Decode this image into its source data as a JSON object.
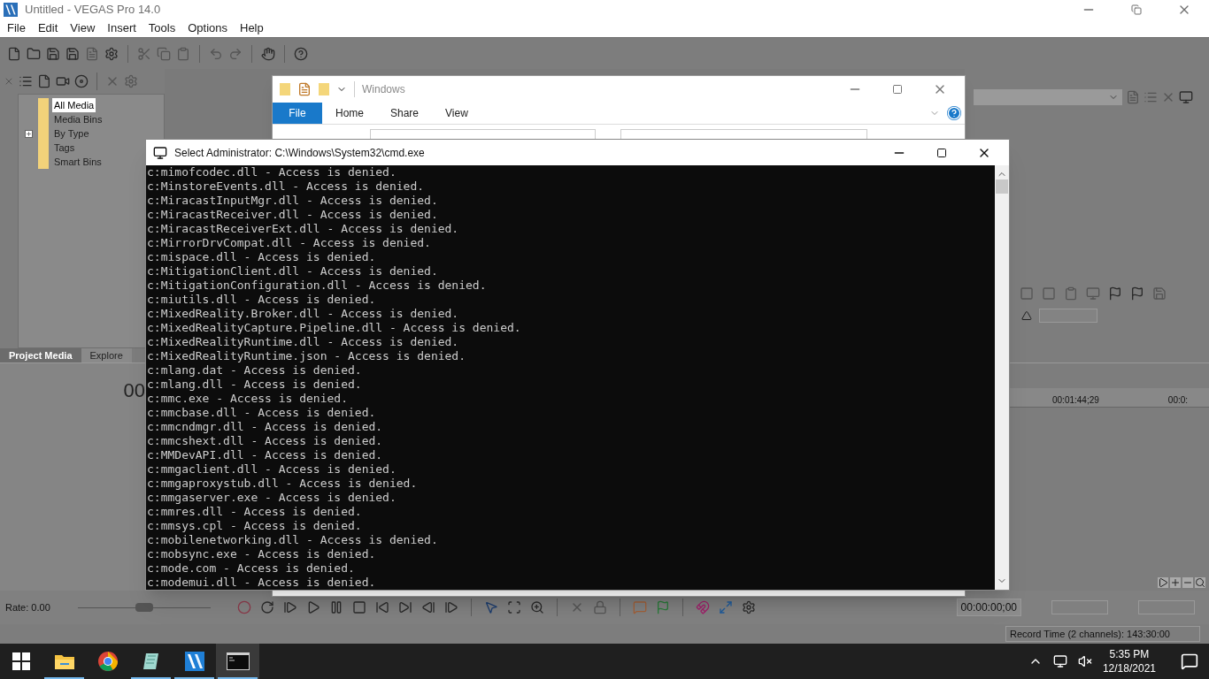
{
  "vegas": {
    "title": "Untitled - VEGAS Pro 14.0",
    "menu": [
      "File",
      "Edit",
      "View",
      "Insert",
      "Tools",
      "Options",
      "Help"
    ],
    "media_tree": [
      {
        "label": "All Media",
        "selected": true,
        "expandable": false
      },
      {
        "label": "Media Bins",
        "selected": false,
        "expandable": false
      },
      {
        "label": "By Type",
        "selected": false,
        "expandable": true
      },
      {
        "label": "Tags",
        "selected": false,
        "expandable": false
      },
      {
        "label": "Smart Bins",
        "selected": false,
        "expandable": false
      }
    ],
    "panel_tabs": [
      {
        "label": "Project Media",
        "selected": true
      },
      {
        "label": "Explore",
        "selected": false
      }
    ],
    "time_display": "00",
    "ruler_labels": [
      "00:01:44;29",
      "00:0:"
    ],
    "rate": "Rate: 0.00",
    "rate_slider": {
      "level": 0.5
    },
    "cursor_time": "00:00:00;00",
    "status": "Record Time (2 channels): 143:30:00"
  },
  "explorer": {
    "title": "Windows",
    "ribbon_tabs": [
      {
        "label": "File",
        "selected": true
      },
      {
        "label": "Home",
        "selected": false
      },
      {
        "label": "Share",
        "selected": false
      },
      {
        "label": "View",
        "selected": false
      }
    ]
  },
  "cmd": {
    "title": "Select Administrator: C:\\Windows\\System32\\cmd.exe",
    "lines": [
      "c:mimofcodec.dll - Access is denied.",
      "c:MinstoreEvents.dll - Access is denied.",
      "c:MiracastInputMgr.dll - Access is denied.",
      "c:MiracastReceiver.dll - Access is denied.",
      "c:MiracastReceiverExt.dll - Access is denied.",
      "c:MirrorDrvCompat.dll - Access is denied.",
      "c:mispace.dll - Access is denied.",
      "c:MitigationClient.dll - Access is denied.",
      "c:MitigationConfiguration.dll - Access is denied.",
      "c:miutils.dll - Access is denied.",
      "c:MixedReality.Broker.dll - Access is denied.",
      "c:MixedRealityCapture.Pipeline.dll - Access is denied.",
      "c:MixedRealityRuntime.dll - Access is denied.",
      "c:MixedRealityRuntime.json - Access is denied.",
      "c:mlang.dat - Access is denied.",
      "c:mlang.dll - Access is denied.",
      "c:mmc.exe - Access is denied.",
      "c:mmcbase.dll - Access is denied.",
      "c:mmcndmgr.dll - Access is denied.",
      "c:mmcshext.dll - Access is denied.",
      "c:MMDevAPI.dll - Access is denied.",
      "c:mmgaclient.dll - Access is denied.",
      "c:mmgaproxystub.dll - Access is denied.",
      "c:mmgaserver.exe - Access is denied.",
      "c:mmres.dll - Access is denied.",
      "c:mmsys.cpl - Access is denied.",
      "c:mobilenetworking.dll - Access is denied.",
      "c:mobsync.exe - Access is denied.",
      "c:mode.com - Access is denied.",
      "c:modemui.dll - Access is denied."
    ]
  },
  "taskbar": {
    "apps": [
      {
        "kind": "explorer",
        "running": true,
        "active": false
      },
      {
        "kind": "chrome",
        "running": false,
        "active": false
      },
      {
        "kind": "notepad",
        "running": true,
        "active": false
      },
      {
        "kind": "vegas",
        "running": true,
        "active": false
      },
      {
        "kind": "cmd",
        "running": true,
        "active": true
      }
    ],
    "time": "5:35 PM",
    "date": "12/18/2021"
  }
}
